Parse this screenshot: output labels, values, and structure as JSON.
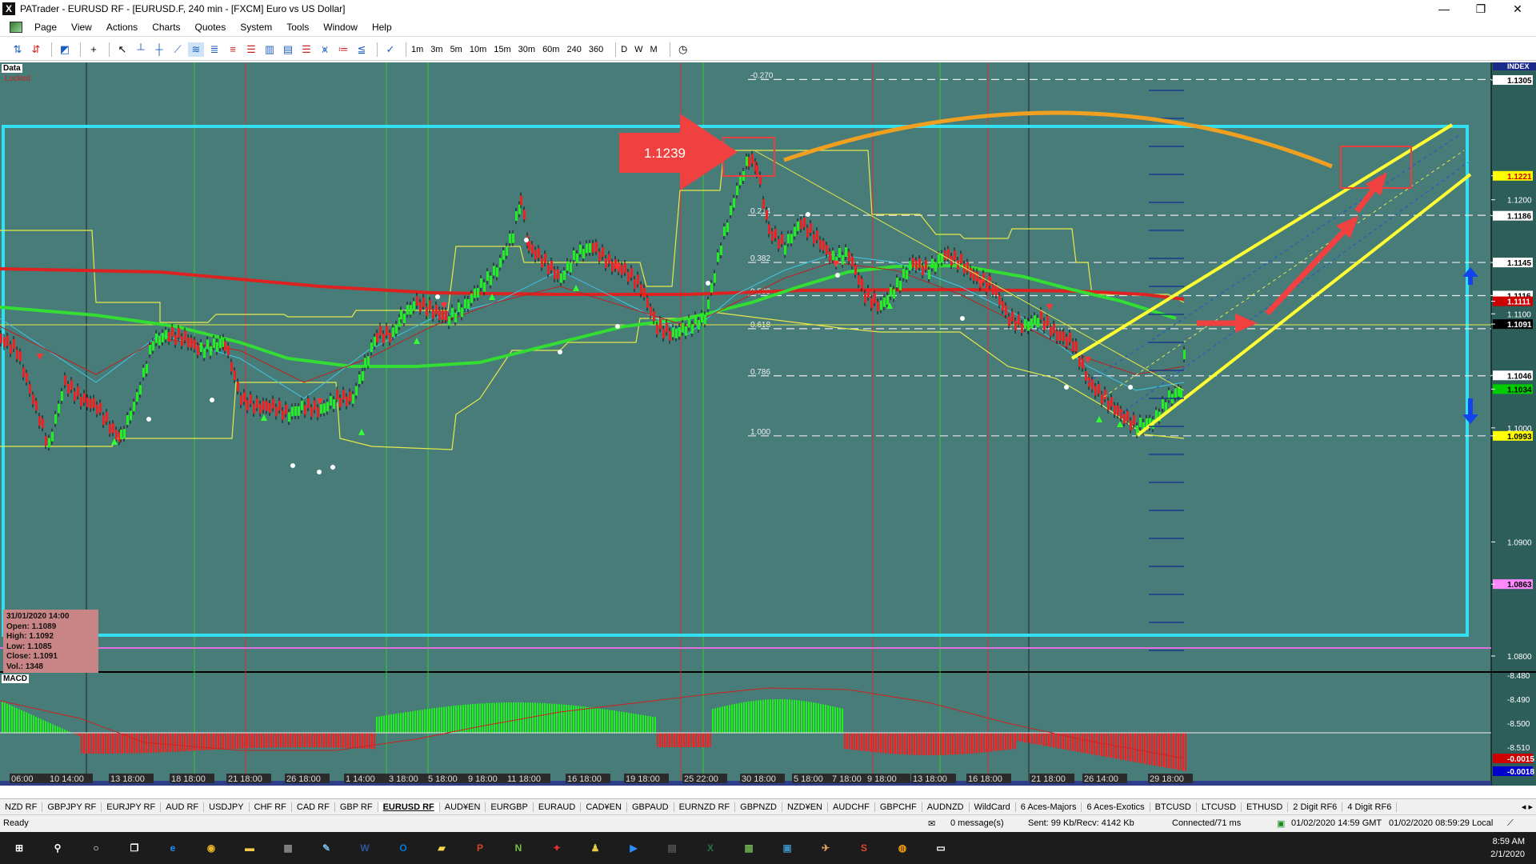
{
  "window": {
    "title": "PATrader - EURUSD RF - [EURUSD.F, 240 min - [FXCM] Euro vs US Dollar]",
    "app_icon_glyph": "X",
    "controls": [
      "—",
      "❐",
      "✕"
    ],
    "mdi_controls": [
      "–",
      "⧉",
      "✕"
    ]
  },
  "menu": {
    "items": [
      "Page",
      "View",
      "Actions",
      "Charts",
      "Quotes",
      "System",
      "Tools",
      "Window",
      "Help"
    ]
  },
  "toolbar": {
    "timeframes": [
      "1m",
      "3m",
      "5m",
      "10m",
      "15m",
      "30m",
      "60m",
      "240",
      "360"
    ],
    "periods": [
      "D",
      "W",
      "M"
    ],
    "icons": [
      "bar-chart-icon",
      "candle-chart-icon",
      "indicator-icon",
      "crosshair-icon",
      "pointer-icon",
      "horizontal-line-icon",
      "vertical-line-icon",
      "trend-line-icon",
      "channel-icon",
      "fibonacci-icon",
      "fib-extension-icon",
      "gann-icon",
      "grid-icon",
      "rectangle-icon",
      "text-icon",
      "pitchfork-icon",
      "arrow-icon",
      "pencil-icon",
      "clock-icon"
    ]
  },
  "chart": {
    "data_tag": "Data",
    "locked_tag": "Locked",
    "macd_tag": "MACD",
    "annotation_price": "1.1239",
    "index_label": "INDEX",
    "price_levels": [
      {
        "label": "1.1305",
        "value": 1.1305,
        "bg": "#ffffff",
        "fg": "#000000"
      },
      {
        "label": "1.1221",
        "value": 1.1221,
        "bg": "#ffff00",
        "fg": "#cc0000"
      },
      {
        "label": "1.1200",
        "value": 1.12,
        "bg": "",
        "fg": "#ffffff"
      },
      {
        "label": "1.1186",
        "value": 1.1186,
        "bg": "#ffffff",
        "fg": "#000000"
      },
      {
        "label": "1.1145",
        "value": 1.1145,
        "bg": "#ffffff",
        "fg": "#000000"
      },
      {
        "label": "1.1116",
        "value": 1.1116,
        "bg": "#ffffff",
        "fg": "#000000"
      },
      {
        "label": "1.1111",
        "value": 1.1111,
        "bg": "#cc0000",
        "fg": "#ffffff"
      },
      {
        "label": "1.1100",
        "value": 1.11,
        "bg": "",
        "fg": "#ffffff"
      },
      {
        "label": "1.1091",
        "value": 1.1091,
        "bg": "#000000",
        "fg": "#ffffff"
      },
      {
        "label": "1.1046",
        "value": 1.1046,
        "bg": "#ffffff",
        "fg": "#000000"
      },
      {
        "label": "1.1034",
        "value": 1.1034,
        "bg": "#00cc00",
        "fg": "#000000"
      },
      {
        "label": "1.1000",
        "value": 1.1,
        "bg": "",
        "fg": "#ffffff"
      },
      {
        "label": "1.0993",
        "value": 1.0993,
        "bg": "#ffff00",
        "fg": "#000000"
      },
      {
        "label": "1.0900",
        "value": 1.09,
        "bg": "",
        "fg": "#ffffff"
      },
      {
        "label": "1.0863",
        "value": 1.0863,
        "bg": "#ff88ff",
        "fg": "#000000"
      },
      {
        "label": "1.0800",
        "value": 1.08,
        "bg": "",
        "fg": "#ffffff"
      }
    ],
    "macd_axis": [
      "-8.480",
      "-8.490",
      "-8.500",
      "-8.510"
    ],
    "macd_values": [
      {
        "label": "-0.0015",
        "bg": "#cc0000"
      },
      {
        "label": "-0.0018",
        "bg": "#0000cc"
      }
    ],
    "fib_labels": [
      {
        "label": "-0.270",
        "level": -0.27
      },
      {
        "label": "0.214",
        "level": 0.214
      },
      {
        "label": "0.382",
        "level": 0.382
      },
      {
        "label": "0.500",
        "level": 0.5
      },
      {
        "label": "0.618",
        "level": 0.618
      },
      {
        "label": "0.786",
        "level": 0.786
      },
      {
        "label": "1.000",
        "level": 1.0
      }
    ],
    "fib_high": 1.1239,
    "fib_low": 1.0993,
    "time_labels": [
      "06:00",
      "10 14:00",
      "13 18:00",
      "18 18:00",
      "21 18:00",
      "26 18:00",
      "1 14:00",
      "3 18:00",
      "5 18:00",
      "9 18:00",
      "11 18:00",
      "16 18:00",
      "19 18:00",
      "25 22:00",
      "30 18:00",
      "5 18:00",
      "7 18:00",
      "9 18:00",
      "13 18:00",
      "16 18:00",
      "21 18:00",
      "26 14:00",
      "29 18:00"
    ],
    "ohlc": {
      "date": "31/01/2020 14:00",
      "open": "Open: 1.1089",
      "high": "High: 1.1092",
      "low": "Low: 1.1085",
      "close": "Close: 1.1091",
      "vol": "Vol.: 1348"
    },
    "colors": {
      "background": "#477c78",
      "grid_red": "#cc3333",
      "grid_green": "#33cc33",
      "box_cyan": "#33e0f0",
      "channel_yellow": "#ffff33",
      "arc_orange": "#f0a020",
      "arrow_red": "#f04040"
    }
  },
  "symbol_tabs": [
    "NZD RF",
    "GBPJPY RF",
    "EURJPY RF",
    "AUD RF",
    "USDJPY",
    "CHF RF",
    "CAD RF",
    "GBP RF",
    "EURUSD RF",
    "AUD¥EN",
    "EURGBP",
    "EURAUD",
    "CAD¥EN",
    "GBPAUD",
    "EURNZD RF",
    "GBPNZD",
    "NZD¥EN",
    "AUDCHF",
    "GBPCHF",
    "AUDNZD",
    "WildCard",
    "6 Aces-Majors",
    "6 Aces-Exotics",
    "BTCUSD",
    "LTCUSD",
    "ETHUSD",
    "2 Digit RF6",
    "4 Digit RF6"
  ],
  "active_tab": "EURUSD RF",
  "tab_arrows": "◂ ▸",
  "status": {
    "ready": "Ready",
    "messages": "0 message(s)",
    "traffic": "Sent: 99 Kb/Recv: 4142 Kb",
    "connection": "Connected/71 ms",
    "gmt": "01/02/2020 14:59 GMT",
    "local": "01/02/2020 08:59:29 Local"
  },
  "taskbar": {
    "time": "8:59 AM",
    "date": "2/1/2020",
    "apps": [
      {
        "name": "windows-start-icon",
        "glyph": "⊞",
        "color": "#ffffff"
      },
      {
        "name": "search-icon",
        "glyph": "⚲",
        "color": "#ffffff"
      },
      {
        "name": "cortana-icon",
        "glyph": "○",
        "color": "#ffffff"
      },
      {
        "name": "task-view-icon",
        "glyph": "❐",
        "color": "#ffffff"
      },
      {
        "name": "edge-icon",
        "glyph": "e",
        "color": "#1e90ff"
      },
      {
        "name": "chrome-icon",
        "glyph": "◉",
        "color": "#e8b52a"
      },
      {
        "name": "file-explorer-icon",
        "glyph": "▬",
        "color": "#f2c94c"
      },
      {
        "name": "patrader-icon",
        "glyph": "▦",
        "color": "#888888"
      },
      {
        "name": "notes-icon",
        "glyph": "✎",
        "color": "#7ab8e0"
      },
      {
        "name": "word-icon",
        "glyph": "W",
        "color": "#2b579a"
      },
      {
        "name": "outlook-icon",
        "glyph": "O",
        "color": "#0078d4"
      },
      {
        "name": "sticky-notes-icon",
        "glyph": "▰",
        "color": "#f6d84a"
      },
      {
        "name": "powerpoint-icon",
        "glyph": "P",
        "color": "#d24726"
      },
      {
        "name": "n-app-icon",
        "glyph": "N",
        "color": "#7ac143"
      },
      {
        "name": "red-app-icon",
        "glyph": "✦",
        "color": "#e03030"
      },
      {
        "name": "game-icon",
        "glyph": "♟",
        "color": "#e8c84a"
      },
      {
        "name": "zoom-icon",
        "glyph": "▶",
        "color": "#2d8cff"
      },
      {
        "name": "calculator-icon",
        "glyph": "▤",
        "color": "#555555"
      },
      {
        "name": "excel-icon",
        "glyph": "X",
        "color": "#217346"
      },
      {
        "name": "photo-icon",
        "glyph": "▩",
        "color": "#6aa84f"
      },
      {
        "name": "news-icon",
        "glyph": "▣",
        "color": "#3c8dbc"
      },
      {
        "name": "tool-icon",
        "glyph": "✈",
        "color": "#e0a060"
      },
      {
        "name": "snagit-icon",
        "glyph": "S",
        "color": "#e04a2a"
      },
      {
        "name": "bitcoin-icon",
        "glyph": "◍",
        "color": "#f39c12"
      },
      {
        "name": "window-icon",
        "glyph": "▭",
        "color": "#ffffff"
      }
    ]
  }
}
